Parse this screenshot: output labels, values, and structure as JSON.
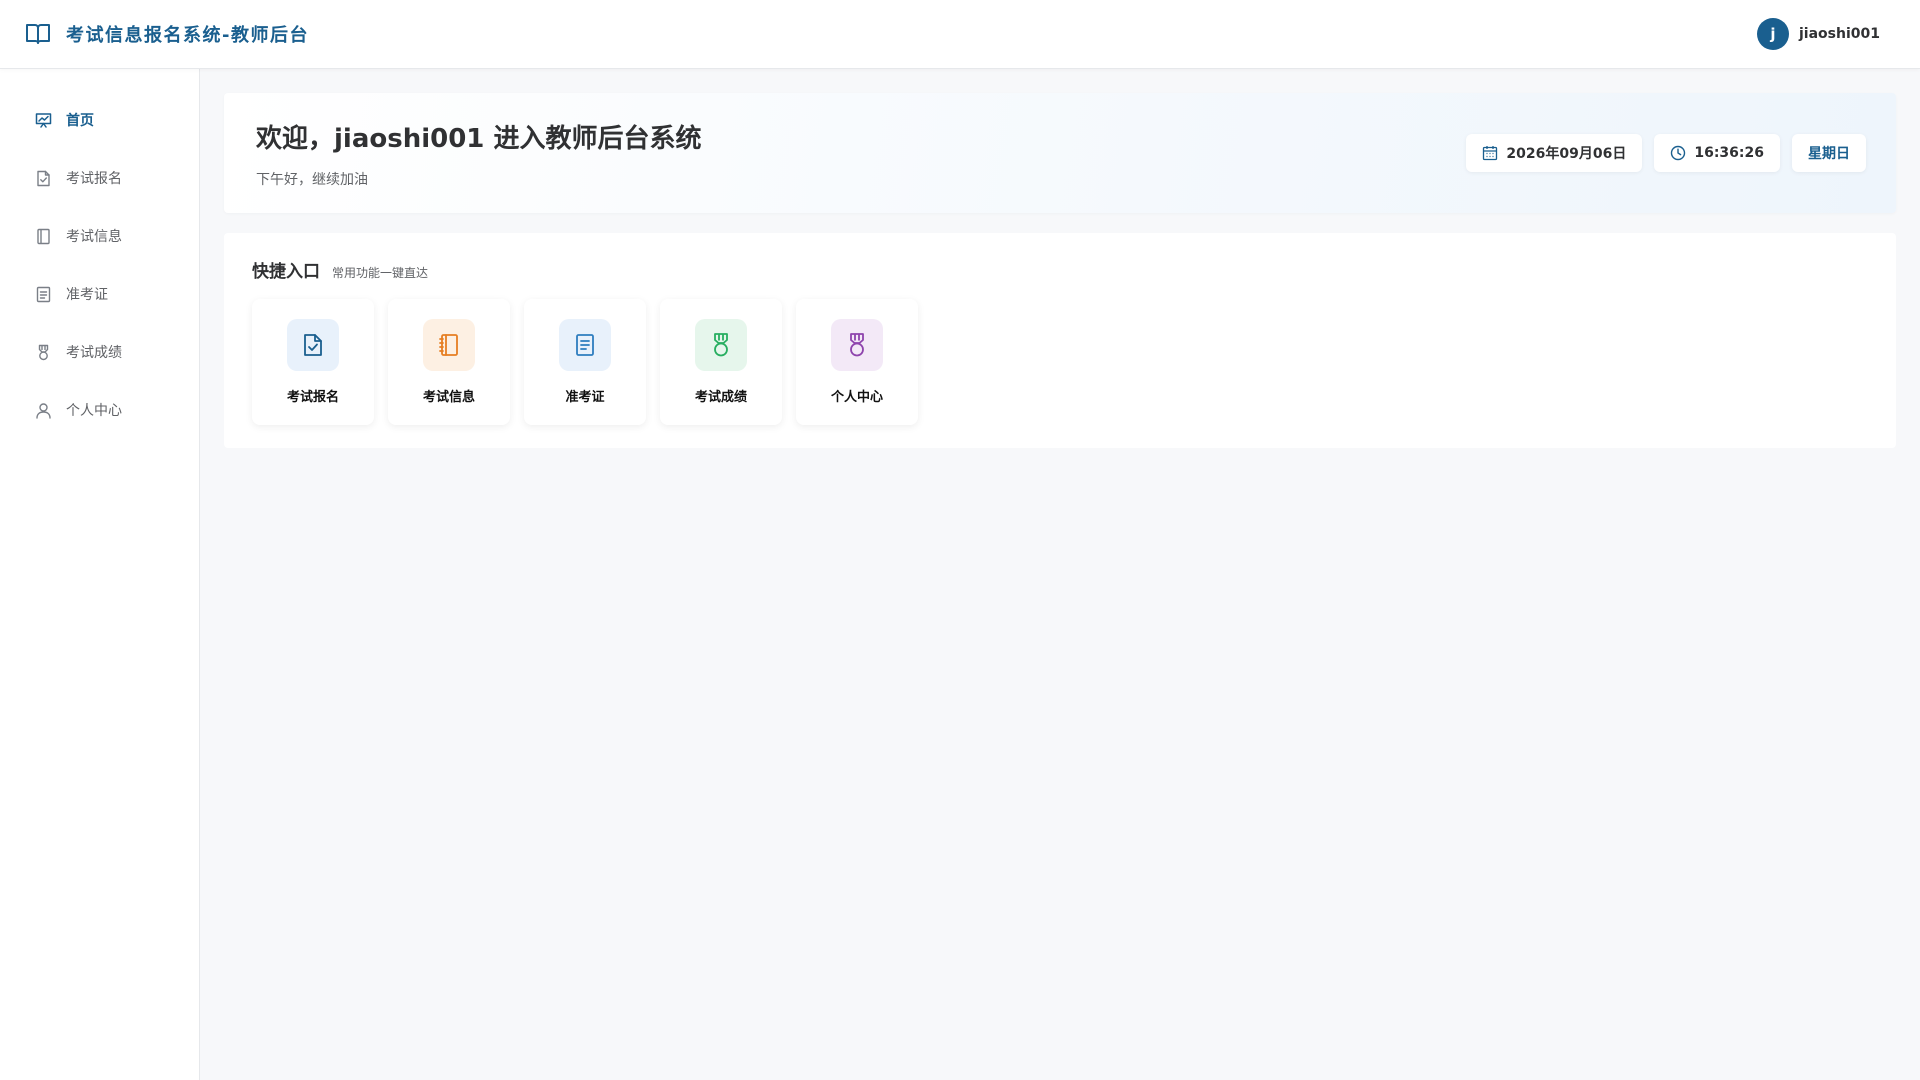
{
  "app": {
    "title": "考试信息报名系统-教师后台"
  },
  "user": {
    "avatar_initial": "j",
    "name": "jiaoshi001"
  },
  "sidebar": {
    "items": [
      {
        "label": "首页",
        "icon": "dashboard-chart-icon",
        "active": true
      },
      {
        "label": "考试报名",
        "icon": "document-check-icon"
      },
      {
        "label": "考试信息",
        "icon": "notebook-icon"
      },
      {
        "label": "准考证",
        "icon": "document-list-icon"
      },
      {
        "label": "考试成绩",
        "icon": "medal-icon"
      },
      {
        "label": "个人中心",
        "icon": "user-icon"
      }
    ]
  },
  "welcome": {
    "title": "欢迎，jiaoshi001 进入教师后台系统",
    "subtitle": "下午好，继续加油",
    "date": "2026年09月06日",
    "time": "16:36:26",
    "weekday": "星期日"
  },
  "quick": {
    "title": "快捷入口",
    "subtitle": "常用功能一键直达",
    "cards": [
      {
        "label": "考试报名",
        "icon": "document-check-icon",
        "color": "#1a5f8f",
        "bg": "#e8f1fb"
      },
      {
        "label": "考试信息",
        "icon": "notebook-icon",
        "color": "#e67e22",
        "bg": "#fdf0e3"
      },
      {
        "label": "准考证",
        "icon": "document-list-icon",
        "color": "#2d7dbf",
        "bg": "#e8f1fb"
      },
      {
        "label": "考试成绩",
        "icon": "medal-icon",
        "color": "#27ae60",
        "bg": "#e6f6ec"
      },
      {
        "label": "个人中心",
        "icon": "medal-icon",
        "color": "#8e44ad",
        "bg": "#f3e9f7"
      }
    ]
  },
  "colors": {
    "brand": "#1a5f8f",
    "background": "#f7f8fa"
  }
}
